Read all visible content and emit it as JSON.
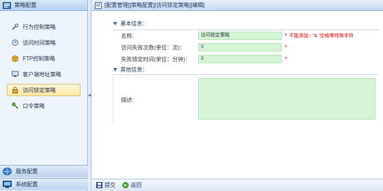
{
  "sidebar": {
    "title": "策略配置",
    "items": [
      {
        "label": "行为控制策略",
        "icon": "tools-icon",
        "active": false
      },
      {
        "label": "访问时间策略",
        "icon": "clock-icon",
        "active": false
      },
      {
        "label": "FTP控制策略",
        "icon": "ftp-icon",
        "active": false
      },
      {
        "label": "客户端地址策略",
        "icon": "computer-icon",
        "active": false
      },
      {
        "label": "访问锁定策略",
        "icon": "lock-icon",
        "active": true
      },
      {
        "label": "口令策略",
        "icon": "key-icon",
        "active": false
      }
    ],
    "footer": [
      {
        "label": "服务配置",
        "icon": "globe-icon"
      },
      {
        "label": "系统配置",
        "icon": "monitor-icon"
      }
    ]
  },
  "breadcrumb": "[配置管理][策略配置][访问锁定策略][编辑]",
  "form": {
    "basic_title": "基本信息：",
    "name_label": "名称:",
    "name_value": "访问锁定策略",
    "name_hint": "不能添加○ \"& '空格等特殊字符",
    "fail_label": "访问失败次数(单位：次)：",
    "fail_value": "3",
    "lock_label": "失败锁定时间(单位：分钟)：",
    "lock_value": "3",
    "required_mark": "*",
    "other_title": "其他信息：",
    "desc_label": "描述:"
  },
  "actions": {
    "submit": "提交",
    "back": "返回"
  }
}
